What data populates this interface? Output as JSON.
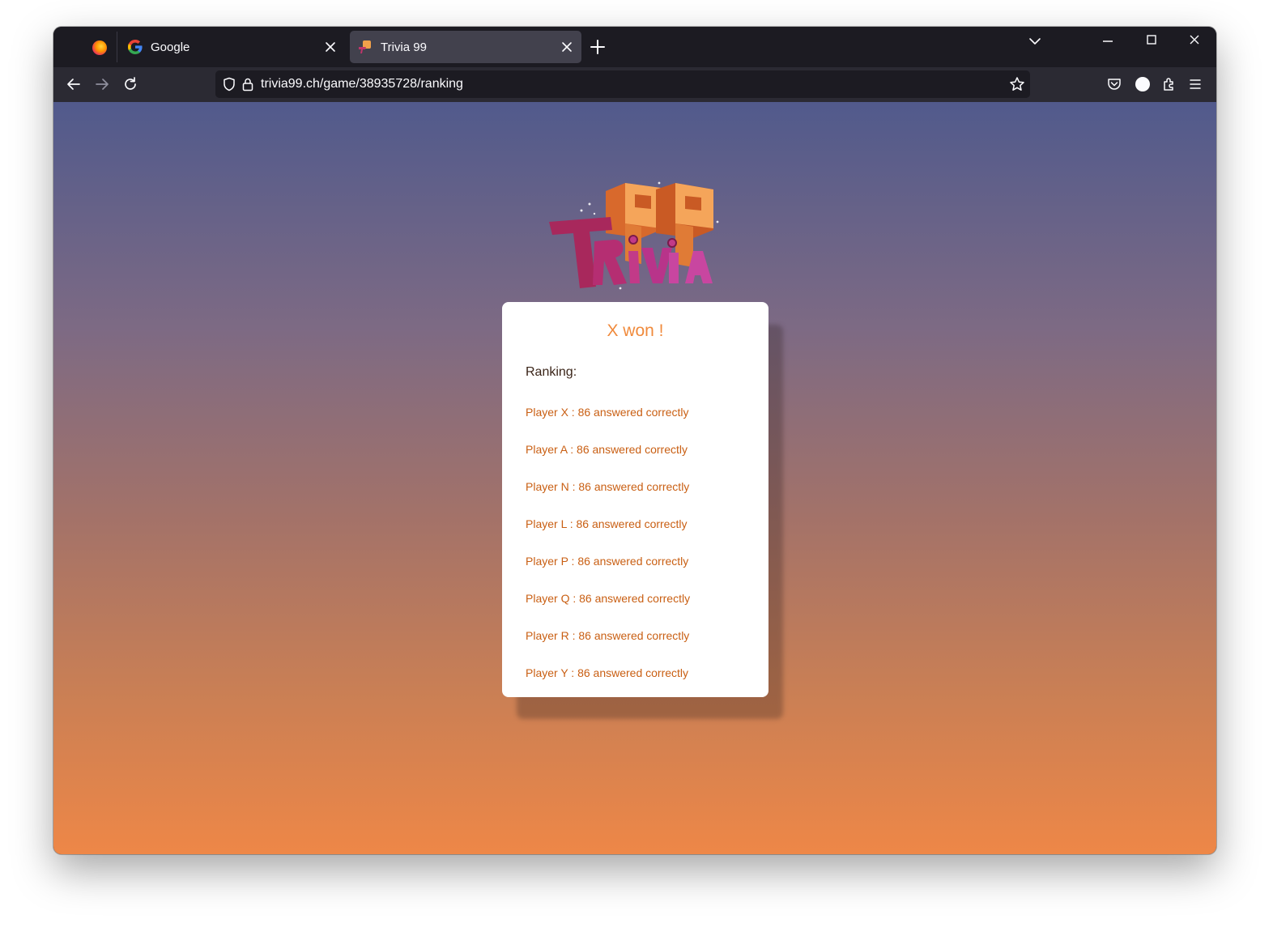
{
  "browser": {
    "tabs": [
      {
        "label": "Google",
        "active": false,
        "icon": "google-icon"
      },
      {
        "label": "Trivia 99",
        "active": true,
        "icon": "trivia99-favicon"
      }
    ],
    "url": "trivia99.ch/game/38935728/ranking"
  },
  "page": {
    "logo_text": "TRiViA 99",
    "winner_text": "X won !",
    "ranking_label": "Ranking:",
    "ranking": [
      "Player X : 86 answered correctly",
      "Player A : 86 answered correctly",
      "Player N : 86 answered correctly",
      "Player L : 86 answered correctly",
      "Player P : 86 answered correctly",
      "Player Q : 86 answered correctly",
      "Player R : 86 answered correctly",
      "Player Y : 86 answered correctly"
    ]
  },
  "colors": {
    "accent": "#f08a3c",
    "ranking_text": "#c95f13",
    "gradient_top": "#515a8c",
    "gradient_bottom": "#ee8747"
  }
}
